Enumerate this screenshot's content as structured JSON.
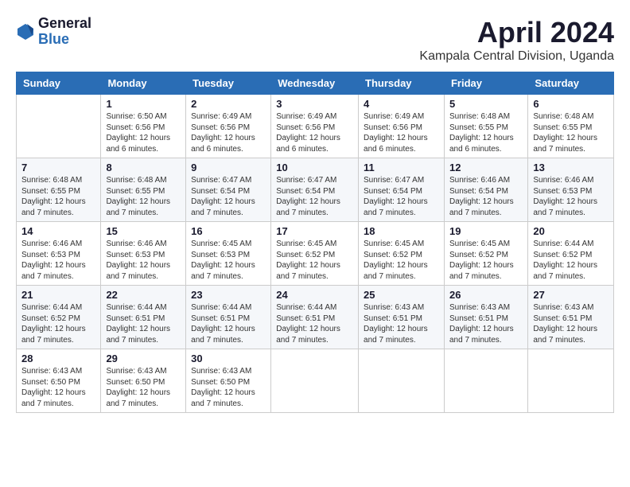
{
  "logo": {
    "general": "General",
    "blue": "Blue"
  },
  "title": "April 2024",
  "subtitle": "Kampala Central Division, Uganda",
  "days": [
    "Sunday",
    "Monday",
    "Tuesday",
    "Wednesday",
    "Thursday",
    "Friday",
    "Saturday"
  ],
  "weeks": [
    [
      {
        "num": "",
        "info": ""
      },
      {
        "num": "1",
        "info": "Sunrise: 6:50 AM\nSunset: 6:56 PM\nDaylight: 12 hours\nand 6 minutes."
      },
      {
        "num": "2",
        "info": "Sunrise: 6:49 AM\nSunset: 6:56 PM\nDaylight: 12 hours\nand 6 minutes."
      },
      {
        "num": "3",
        "info": "Sunrise: 6:49 AM\nSunset: 6:56 PM\nDaylight: 12 hours\nand 6 minutes."
      },
      {
        "num": "4",
        "info": "Sunrise: 6:49 AM\nSunset: 6:56 PM\nDaylight: 12 hours\nand 6 minutes."
      },
      {
        "num": "5",
        "info": "Sunrise: 6:48 AM\nSunset: 6:55 PM\nDaylight: 12 hours\nand 6 minutes."
      },
      {
        "num": "6",
        "info": "Sunrise: 6:48 AM\nSunset: 6:55 PM\nDaylight: 12 hours\nand 7 minutes."
      }
    ],
    [
      {
        "num": "7",
        "info": "Sunrise: 6:48 AM\nSunset: 6:55 PM\nDaylight: 12 hours\nand 7 minutes."
      },
      {
        "num": "8",
        "info": "Sunrise: 6:48 AM\nSunset: 6:55 PM\nDaylight: 12 hours\nand 7 minutes."
      },
      {
        "num": "9",
        "info": "Sunrise: 6:47 AM\nSunset: 6:54 PM\nDaylight: 12 hours\nand 7 minutes."
      },
      {
        "num": "10",
        "info": "Sunrise: 6:47 AM\nSunset: 6:54 PM\nDaylight: 12 hours\nand 7 minutes."
      },
      {
        "num": "11",
        "info": "Sunrise: 6:47 AM\nSunset: 6:54 PM\nDaylight: 12 hours\nand 7 minutes."
      },
      {
        "num": "12",
        "info": "Sunrise: 6:46 AM\nSunset: 6:54 PM\nDaylight: 12 hours\nand 7 minutes."
      },
      {
        "num": "13",
        "info": "Sunrise: 6:46 AM\nSunset: 6:53 PM\nDaylight: 12 hours\nand 7 minutes."
      }
    ],
    [
      {
        "num": "14",
        "info": "Sunrise: 6:46 AM\nSunset: 6:53 PM\nDaylight: 12 hours\nand 7 minutes."
      },
      {
        "num": "15",
        "info": "Sunrise: 6:46 AM\nSunset: 6:53 PM\nDaylight: 12 hours\nand 7 minutes."
      },
      {
        "num": "16",
        "info": "Sunrise: 6:45 AM\nSunset: 6:53 PM\nDaylight: 12 hours\nand 7 minutes."
      },
      {
        "num": "17",
        "info": "Sunrise: 6:45 AM\nSunset: 6:52 PM\nDaylight: 12 hours\nand 7 minutes."
      },
      {
        "num": "18",
        "info": "Sunrise: 6:45 AM\nSunset: 6:52 PM\nDaylight: 12 hours\nand 7 minutes."
      },
      {
        "num": "19",
        "info": "Sunrise: 6:45 AM\nSunset: 6:52 PM\nDaylight: 12 hours\nand 7 minutes."
      },
      {
        "num": "20",
        "info": "Sunrise: 6:44 AM\nSunset: 6:52 PM\nDaylight: 12 hours\nand 7 minutes."
      }
    ],
    [
      {
        "num": "21",
        "info": "Sunrise: 6:44 AM\nSunset: 6:52 PM\nDaylight: 12 hours\nand 7 minutes."
      },
      {
        "num": "22",
        "info": "Sunrise: 6:44 AM\nSunset: 6:51 PM\nDaylight: 12 hours\nand 7 minutes."
      },
      {
        "num": "23",
        "info": "Sunrise: 6:44 AM\nSunset: 6:51 PM\nDaylight: 12 hours\nand 7 minutes."
      },
      {
        "num": "24",
        "info": "Sunrise: 6:44 AM\nSunset: 6:51 PM\nDaylight: 12 hours\nand 7 minutes."
      },
      {
        "num": "25",
        "info": "Sunrise: 6:43 AM\nSunset: 6:51 PM\nDaylight: 12 hours\nand 7 minutes."
      },
      {
        "num": "26",
        "info": "Sunrise: 6:43 AM\nSunset: 6:51 PM\nDaylight: 12 hours\nand 7 minutes."
      },
      {
        "num": "27",
        "info": "Sunrise: 6:43 AM\nSunset: 6:51 PM\nDaylight: 12 hours\nand 7 minutes."
      }
    ],
    [
      {
        "num": "28",
        "info": "Sunrise: 6:43 AM\nSunset: 6:50 PM\nDaylight: 12 hours\nand 7 minutes."
      },
      {
        "num": "29",
        "info": "Sunrise: 6:43 AM\nSunset: 6:50 PM\nDaylight: 12 hours\nand 7 minutes."
      },
      {
        "num": "30",
        "info": "Sunrise: 6:43 AM\nSunset: 6:50 PM\nDaylight: 12 hours\nand 7 minutes."
      },
      {
        "num": "",
        "info": ""
      },
      {
        "num": "",
        "info": ""
      },
      {
        "num": "",
        "info": ""
      },
      {
        "num": "",
        "info": ""
      }
    ]
  ]
}
